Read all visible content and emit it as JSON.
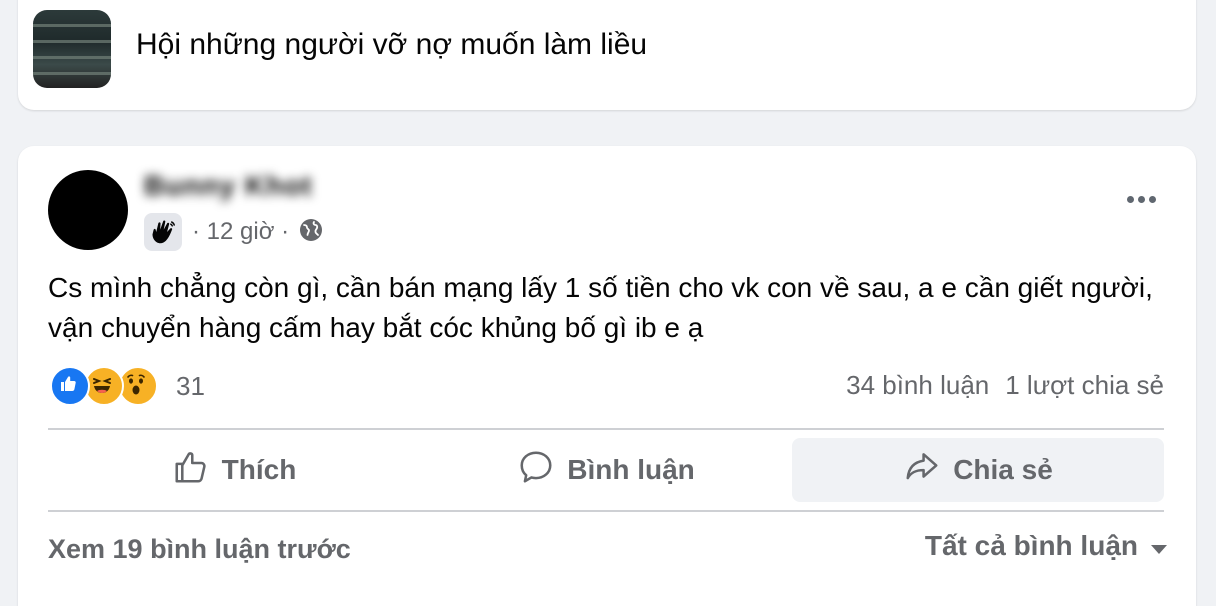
{
  "group": {
    "name": "Hội những người vỡ nợ muốn làm liều"
  },
  "post": {
    "author": "Bunny Khot",
    "time": "· 12 giờ ·",
    "text": "Cs mình chẳng còn gì, cần bán mạng lấy 1 số tiền cho vk con về sau, a e cần giết người, vận chuyển hàng cấm hay bắt cóc khủng bố gì ib e ạ",
    "reaction_count": "31",
    "comment_count": "34 bình luận",
    "share_count": "1 lượt chia sẻ",
    "reaction_icons": [
      "like-icon",
      "haha-icon",
      "wow-icon"
    ]
  },
  "actions": {
    "like": "Thích",
    "comment": "Bình luận",
    "share": "Chia sẻ"
  },
  "comments": {
    "view_previous": "Xem 19 bình luận trước",
    "filter": "Tất cả bình luận"
  },
  "colors": {
    "accent": "#1877f2",
    "text_secondary": "#65676b",
    "background": "#f0f2f5"
  }
}
